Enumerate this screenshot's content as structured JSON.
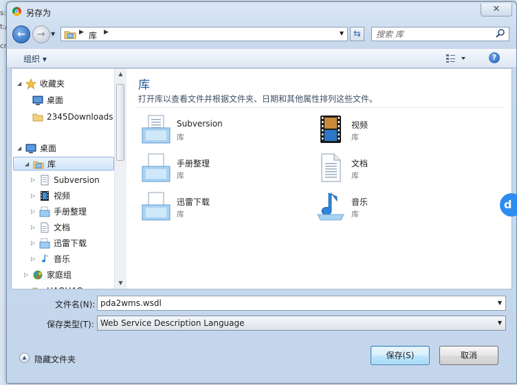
{
  "window": {
    "title": "另存为",
    "close_label": "✕"
  },
  "address": {
    "crumbs": [
      "库"
    ]
  },
  "search": {
    "placeholder": "搜索 库"
  },
  "toolbar": {
    "organize_label": "组织 ▾",
    "help_label": "?"
  },
  "nav": {
    "items": [
      {
        "label": "收藏夹",
        "icon": "star-icon",
        "indent": 0,
        "tri": "◢"
      },
      {
        "label": "桌面",
        "icon": "desktop-icon",
        "indent": 1,
        "tri": ""
      },
      {
        "label": "2345Downloads",
        "icon": "folder-icon",
        "indent": 1,
        "tri": ""
      },
      {
        "label": "桌面",
        "icon": "desktop-icon",
        "indent": 0,
        "tri": "◢"
      },
      {
        "label": "库",
        "icon": "library-icon",
        "indent": 1,
        "tri": "◢",
        "selected": true
      },
      {
        "label": "Subversion",
        "icon": "subversion-icon",
        "indent": 2,
        "tri": "▷"
      },
      {
        "label": "视频",
        "icon": "video-icon",
        "indent": 2,
        "tri": "▷"
      },
      {
        "label": "手册整理",
        "icon": "library-folder-icon",
        "indent": 2,
        "tri": "▷"
      },
      {
        "label": "文档",
        "icon": "document-icon",
        "indent": 2,
        "tri": "▷"
      },
      {
        "label": "迅雷下载",
        "icon": "library-folder-icon",
        "indent": 2,
        "tri": "▷"
      },
      {
        "label": "音乐",
        "icon": "music-icon",
        "indent": 2,
        "tri": "▷"
      },
      {
        "label": "家庭组",
        "icon": "homegroup-icon",
        "indent": 1,
        "tri": "▷"
      },
      {
        "label": "HAOHAO",
        "icon": "user-folder-icon",
        "indent": 1,
        "tri": "▷"
      }
    ]
  },
  "library": {
    "title": "库",
    "description": "打开库以查看文件并根据文件夹、日期和其他属性排列这些文件。",
    "tiles": [
      {
        "name": "Subversion",
        "sub": "库",
        "icon": "subversion-icon"
      },
      {
        "name": "视频",
        "sub": "库",
        "icon": "video-icon"
      },
      {
        "name": "手册整理",
        "sub": "库",
        "icon": "library-folder-icon"
      },
      {
        "name": "文档",
        "sub": "库",
        "icon": "document-icon"
      },
      {
        "name": "迅雷下载",
        "sub": "库",
        "icon": "library-folder-icon"
      },
      {
        "name": "音乐",
        "sub": "库",
        "icon": "music-icon"
      }
    ]
  },
  "form": {
    "filename_label": "文件名(N):",
    "filename_value": "pda2wms.wsdl",
    "filetype_label": "保存类型(T):",
    "filetype_value": "Web Service Description Language"
  },
  "footer": {
    "hide_folders_label": "隐藏文件夹",
    "save_label": "保存(S)",
    "cancel_label": "取消"
  },
  "colors": {
    "accent": "#1e5a96",
    "selection": "#cfe4fa",
    "chrome": "#c8d9ee"
  }
}
